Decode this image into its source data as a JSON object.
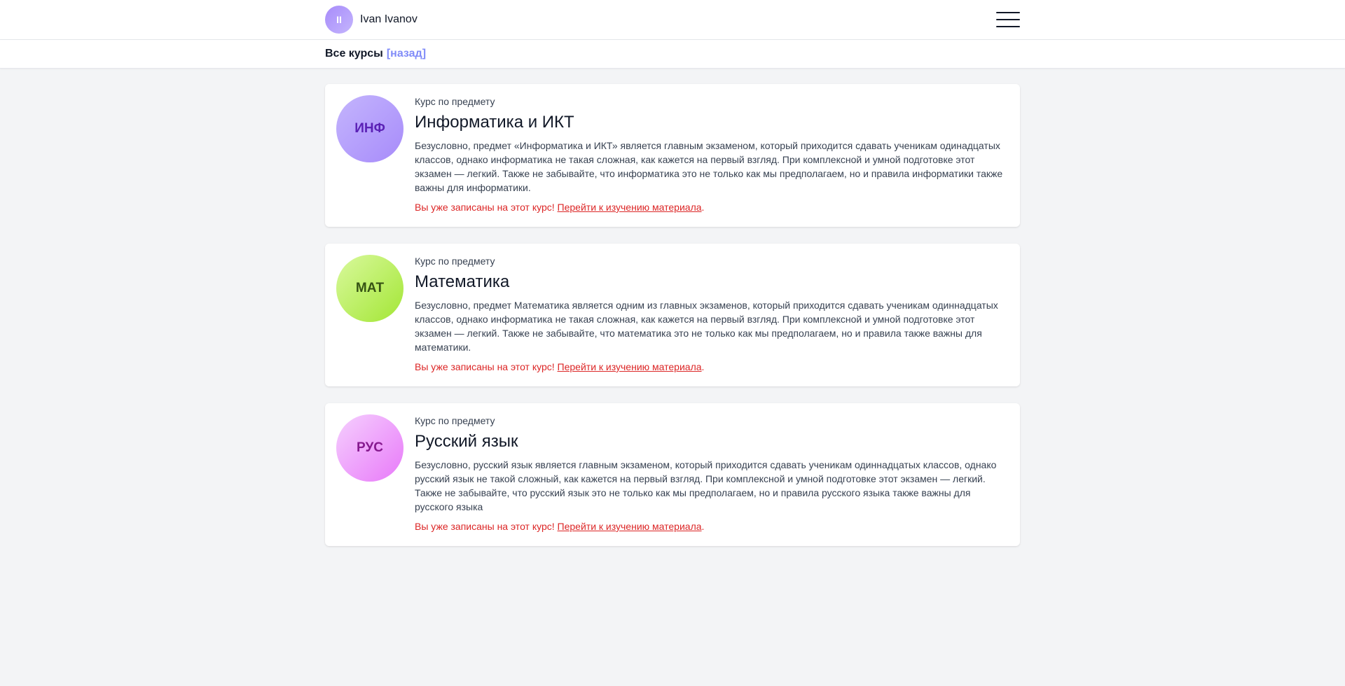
{
  "header": {
    "avatar_initials": "II",
    "user_name": "Ivan Ivanov"
  },
  "breadcrumb": {
    "title": "Все курсы",
    "back_label": "[назад]"
  },
  "courses": [
    {
      "badge": "ИНФ",
      "badge_gradient": [
        "#c4b5fd",
        "#a78bfa"
      ],
      "badge_text_color": "#5b21b6",
      "kicker": "Курс по предмету",
      "title": "Информатика и ИКТ",
      "description": "Безусловно, предмет «Информатика и ИКТ» является главным экзаменом, который приходится сдавать ученикам одинадцатых классов, однако информатика не такая сложная, как кажется на первый взгляд. При комплексной и умной подготовке этот экзамен — легкий. Также не забывайте, что информатика это не только как мы предполагаем, но и правила информатики также важны для информатики.",
      "status_text": "Вы уже записаны на этот курс! ",
      "link_text": "Перейти к изучению материала",
      "tail": "."
    },
    {
      "badge": "МАТ",
      "badge_gradient": [
        "#d9f99d",
        "#a3e635"
      ],
      "badge_text_color": "#365314",
      "kicker": "Курс по предмету",
      "title": "Математика",
      "description": "Безусловно, предмет Математика является одним из главных экзаменов, который приходится сдавать ученикам одиннадцатых классов, однако информатика не такая сложная, как кажется на первый взгляд. При комплексной и умной подготовке этот экзамен — легкий. Также не забывайте, что математика это не только как мы предполагаем, но и правила также важны для математики.",
      "status_text": "Вы уже записаны на этот курс! ",
      "link_text": "Перейти к изучению материала",
      "tail": "."
    },
    {
      "badge": "РУС",
      "badge_gradient": [
        "#f5d0fe",
        "#e879f9"
      ],
      "badge_text_color": "#86198f",
      "kicker": "Курс по предмету",
      "title": "Русский язык",
      "description": "Безусловно, русский язык является главным экзаменом, который приходится сдавать ученикам одиннадцатых классов, однако русский язык не такой сложный, как кажется на первый взгляд. При комплексной и умной подготовке этот экзамен — легкий. Также не забывайте, что русский язык это не только как мы предполагаем, но и правила русского языка также важны для русского языка",
      "status_text": "Вы уже записаны на этот курс! ",
      "link_text": "Перейти к изучению материала",
      "tail": "."
    }
  ]
}
